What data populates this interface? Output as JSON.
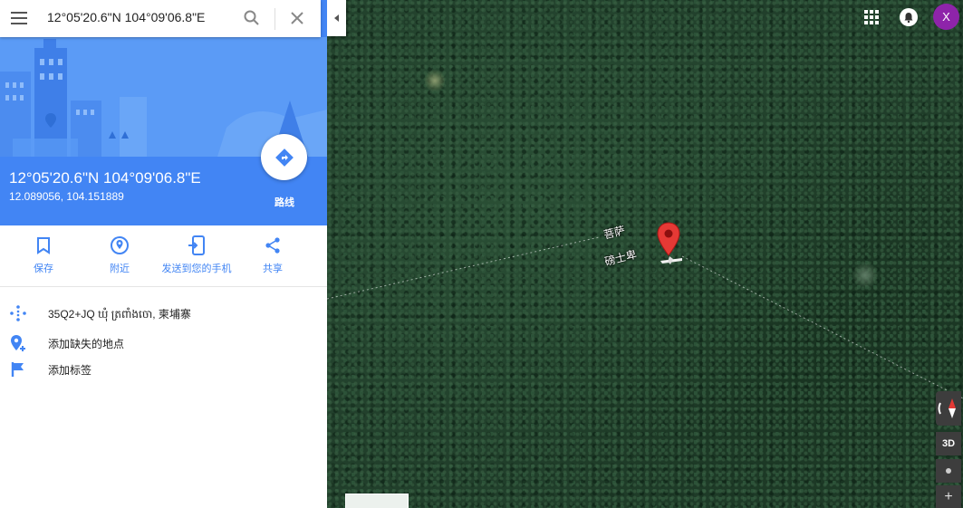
{
  "search": {
    "value": "12°05'20.6\"N 104°09'06.8\"E"
  },
  "place": {
    "title": "12°05'20.6\"N 104°09'06.8\"E",
    "decimal_coords": "12.089056, 104.151889",
    "directions_label": "路线"
  },
  "actions": [
    {
      "label": "保存",
      "icon": "bookmark-icon"
    },
    {
      "label": "附近",
      "icon": "nearby-icon"
    },
    {
      "label": "发送到您的手机",
      "icon": "send-to-phone-icon"
    },
    {
      "label": "共享",
      "icon": "share-icon"
    }
  ],
  "info": [
    {
      "text": "35Q2+JQ ឃុំ ត្រពាំងចោ, 柬埔寨",
      "icon": "plus-code-icon"
    },
    {
      "text": "添加缺失的地点",
      "icon": "add-place-icon"
    },
    {
      "text": "添加标签",
      "icon": "flag-icon"
    }
  ],
  "map": {
    "labels": [
      "菩萨",
      "磅士卑"
    ],
    "avatar_letter": "X",
    "control_3d": "3D",
    "zoom_in": "+",
    "colors": {
      "accent": "#4285f4",
      "pin": "#e53935",
      "avatar": "#8e24aa"
    }
  }
}
